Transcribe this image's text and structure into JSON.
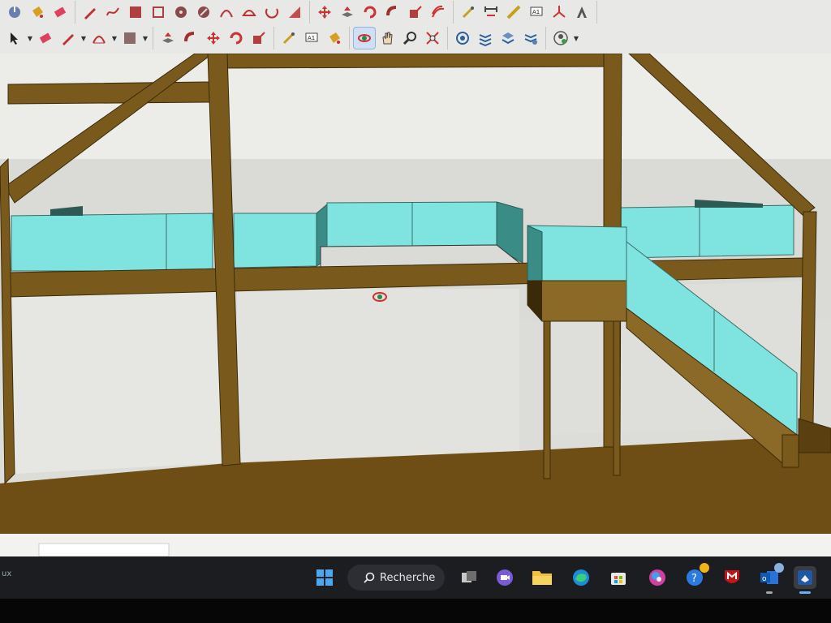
{
  "toolbar": {
    "row1_tools": [
      "tape-measure-icon",
      "paint-bucket-icon",
      "eraser-icon",
      "pencil-icon",
      "freehand-icon",
      "rectangle-icon",
      "rotated-rectangle-icon",
      "circle-icon",
      "polygon-icon",
      "arc-icon",
      "two-point-arc-icon",
      "three-point-arc-icon",
      "pie-icon",
      "move-icon",
      "push-pull-icon",
      "rotate-icon",
      "follow-me-icon",
      "scale-icon",
      "offset-icon",
      "tape-icon",
      "dimension-icon",
      "protractor-icon",
      "text-icon",
      "axes-icon",
      "3d-text-icon"
    ],
    "row2_tools": [
      "select-icon",
      "eraser-icon",
      "line-icon",
      "arc-icon",
      "rectangle-icon",
      "push-pull-icon",
      "offset-icon",
      "move-icon",
      "rotate-icon",
      "scale-icon",
      "tape-measure-icon",
      "text-icon",
      "paint-bucket-icon",
      "orbit-icon",
      "pan-icon",
      "zoom-icon",
      "zoom-extents-icon",
      "warehouse-icon",
      "extension-warehouse-icon",
      "layers-icon",
      "styles-icon",
      "account-icon"
    ],
    "active_tool": "orbit-icon",
    "text_tool_label": "A1"
  },
  "colors": {
    "wood": "#7a5a1c",
    "wood_dark": "#5d4212",
    "glass": "#7fe3e0",
    "glass_dark": "#3a8c86",
    "floor": "#6e4e14",
    "wall": "#e4e4e0",
    "sky": "#ecece8"
  },
  "taskbar": {
    "search_label": "Recherche",
    "left_edge_text": "ux",
    "apps": [
      "windows-start-icon",
      "search",
      "task-view-icon",
      "meet-icon",
      "file-explorer-icon",
      "edge-icon",
      "store-icon",
      "paint-icon",
      "help-icon",
      "mcafee-icon",
      "outlook-icon",
      "sketchup-icon"
    ]
  }
}
